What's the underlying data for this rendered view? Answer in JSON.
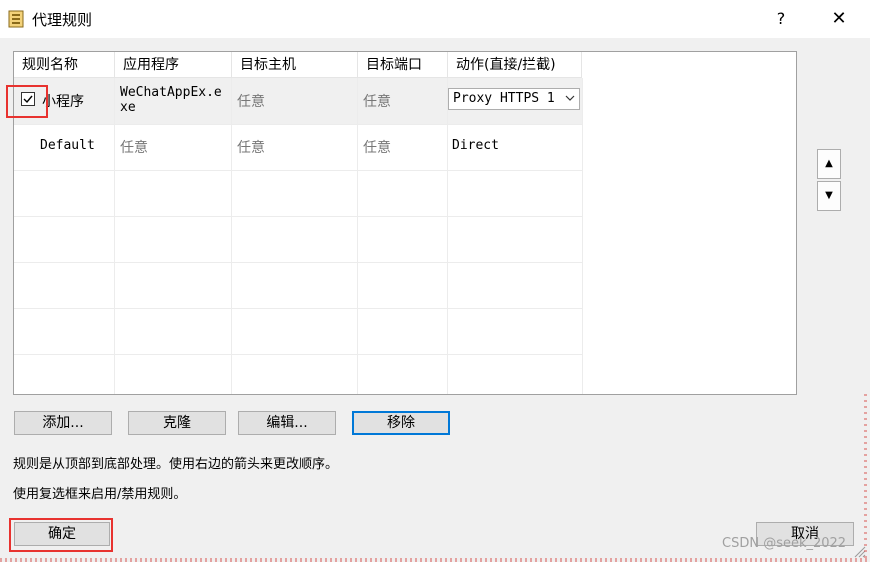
{
  "window": {
    "title": "代理规则",
    "help_label": "?",
    "close_label": "✕",
    "icon": "app-icon"
  },
  "table": {
    "columns": [
      "规则名称",
      "应用程序",
      "目标主机",
      "目标端口",
      "动作(直接/拦截)"
    ],
    "rows": [
      {
        "checked": true,
        "name": "小程序",
        "app_line1": "WeChatAppEx.e",
        "app_line2": "xe",
        "host": "任意",
        "port": "任意",
        "action": "Proxy HTTPS 1"
      },
      {
        "checked": false,
        "name": "Default",
        "app": "任意",
        "host": "任意",
        "port": "任意",
        "action": "Direct"
      }
    ]
  },
  "side_buttons": {
    "up_label": "▲",
    "down_label": "▼"
  },
  "buttons": {
    "add": "添加...",
    "clone": "克隆",
    "edit": "编辑...",
    "remove": "移除",
    "ok": "确定",
    "cancel": "取消"
  },
  "info": {
    "line1": "规则是从顶部到底部处理。使用右边的箭头来更改顺序。",
    "line2": "使用复选框来启用/禁用规则。"
  },
  "watermark": "CSDN @seek_2022",
  "colors": {
    "accent": "#0078d7",
    "highlight": "#e8322f"
  }
}
